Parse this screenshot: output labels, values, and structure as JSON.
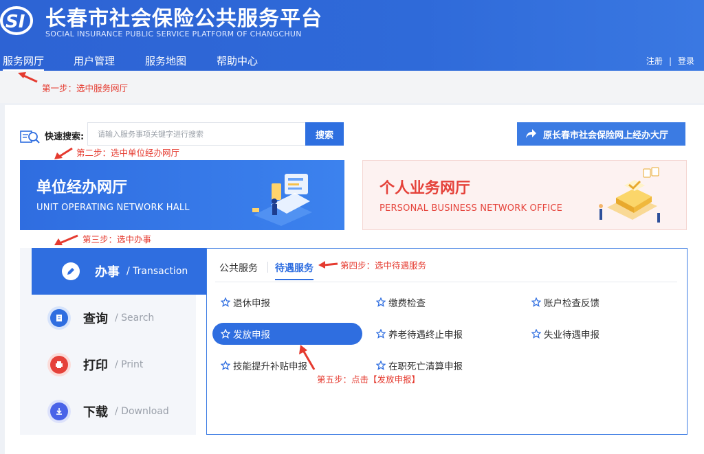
{
  "header": {
    "logo_text": "SI",
    "title": "长春市社会保险公共服务平台",
    "subtitle": "SOCIAL INSURANCE PUBLIC SERVICE PLATFORM OF CHANGCHUN",
    "nav": [
      "服务网厅",
      "用户管理",
      "服务地图",
      "帮助中心"
    ],
    "links": {
      "register": "注册",
      "separator": "|",
      "login": "登录"
    }
  },
  "annotations": {
    "step1": "第一步：选中服务网厅",
    "step2": "第二步：选中单位经办网厅",
    "step3": "第三步：选中办事",
    "step4": "第四步：选中待遇服务",
    "step5": "第五步：点击【发放申报】"
  },
  "search": {
    "label": "快速搜索:",
    "placeholder": "请输入服务事项关键字进行搜索",
    "button": "搜索"
  },
  "legacy_link": "原长春市社会保险网上经办大厅",
  "halls": {
    "unit": {
      "title": "单位经办网厅",
      "subtitle": "UNIT OPERATING NETWORK HALL"
    },
    "personal": {
      "title": "个人业务网厅",
      "subtitle": "PERSONAL BUSINESS NETWORK OFFICE"
    }
  },
  "side_menu": [
    {
      "title": "办事",
      "en": "/ Transaction",
      "icon": "edit-icon",
      "color": "#2f6ee0"
    },
    {
      "title": "查询",
      "en": "/ Search",
      "icon": "document-icon",
      "color": "#2f6ee0"
    },
    {
      "title": "打印",
      "en": "/ Print",
      "icon": "printer-icon",
      "color": "#e5423a"
    },
    {
      "title": "下载",
      "en": "/ Download",
      "icon": "download-icon",
      "color": "#4a63e8"
    }
  ],
  "tabs": {
    "public": "公共服务",
    "treatment": "待遇服务"
  },
  "services": [
    [
      "退休申报",
      "缴费检查",
      "账户检查反馈"
    ],
    [
      "发放申报",
      "养老待遇终止申报",
      "失业待遇申报"
    ],
    [
      "技能提升补贴申报",
      "在职死亡清算申报"
    ]
  ],
  "colors": {
    "primary": "#2f6ee0",
    "annotation": "#e53a2f",
    "personal_accent": "#e5423a"
  }
}
